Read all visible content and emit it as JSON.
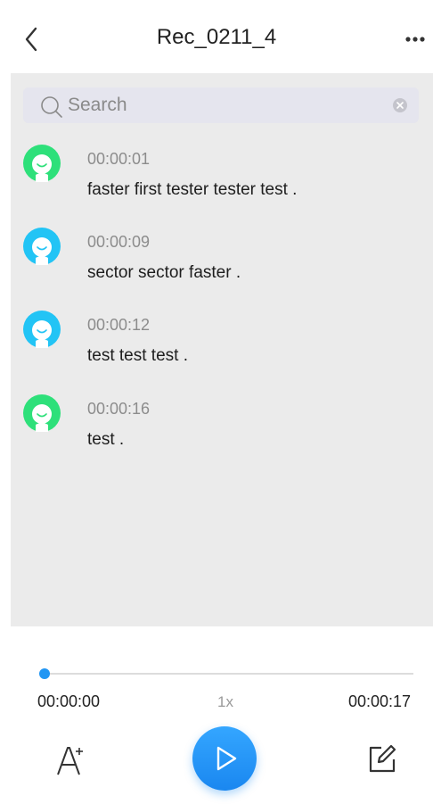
{
  "header": {
    "title": "Rec_0211_4"
  },
  "search": {
    "placeholder": "Search",
    "value": ""
  },
  "transcript": [
    {
      "time": "00:00:01",
      "text": "faster first tester tester test .",
      "avatar_color": "#2ee07a"
    },
    {
      "time": "00:00:09",
      "text": "sector sector faster .",
      "avatar_color": "#22c4f5"
    },
    {
      "time": "00:00:12",
      "text": "test test test .",
      "avatar_color": "#22c4f5"
    },
    {
      "time": "00:00:16",
      "text": "test .",
      "avatar_color": "#2ee07a"
    }
  ],
  "player": {
    "current_time": "00:00:00",
    "total_time": "00:00:17",
    "speed": "1x",
    "progress": 0
  },
  "colors": {
    "accent": "#2196f3",
    "panel_bg": "#ebebeb"
  },
  "icons": {
    "back": "back-chevron-icon",
    "more": "more-dots-icon",
    "search": "search-icon",
    "clear": "clear-circle-icon",
    "font_size": "font-size-icon",
    "play": "play-icon",
    "edit": "edit-icon"
  }
}
